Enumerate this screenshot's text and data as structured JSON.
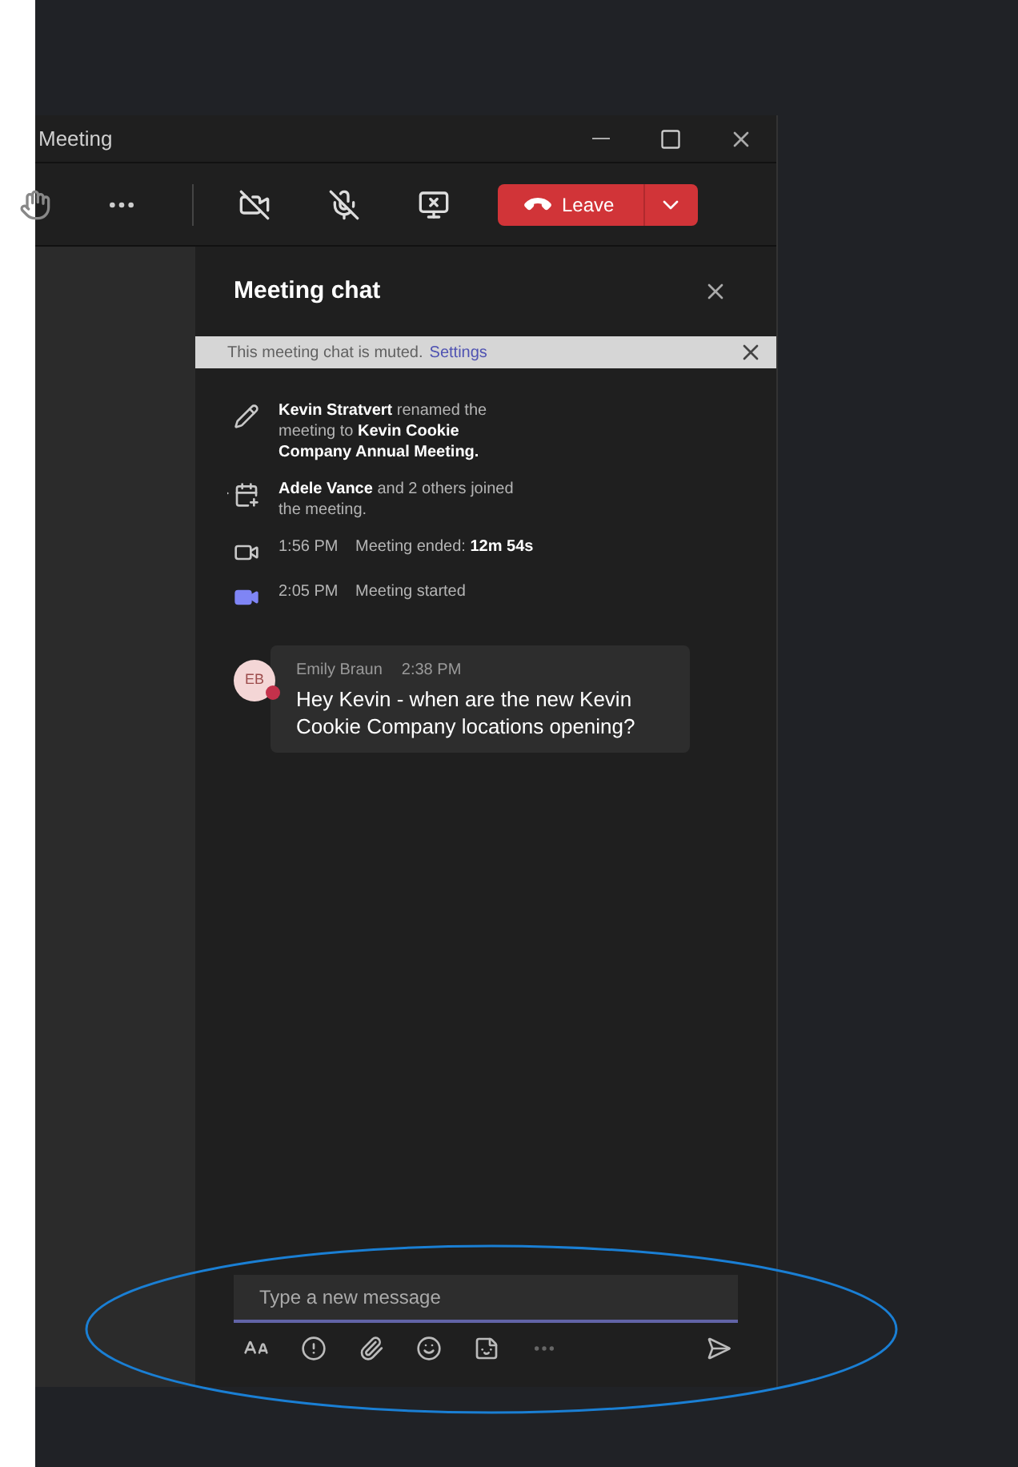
{
  "window": {
    "title": "Meeting"
  },
  "toolbar": {
    "leave_label": "Leave"
  },
  "chat": {
    "title": "Meeting chat",
    "banner": {
      "text": "This meeting chat is muted.",
      "link": "Settings"
    },
    "events": [
      {
        "kind": "rename",
        "text": "**Kevin Stratvert** renamed the meeting to **Kevin Cookie Company Annual Meeting.**"
      },
      {
        "kind": "joined",
        "text": "**Adele Vance** and 2 others joined the meeting."
      },
      {
        "kind": "ended",
        "time": "1:56 PM",
        "text": "Meeting ended: **12m 54s**"
      },
      {
        "kind": "started",
        "time": "2:05 PM",
        "text": "Meeting started"
      }
    ],
    "messages": [
      {
        "initials": "EB",
        "color": "#c4314b",
        "author": "Emily Braun",
        "time": "2:38 PM",
        "text": "Hey Kevin - when are the new Kevin Cookie Company locations opening?"
      }
    ],
    "compose": {
      "placeholder": "Type a new message"
    }
  }
}
